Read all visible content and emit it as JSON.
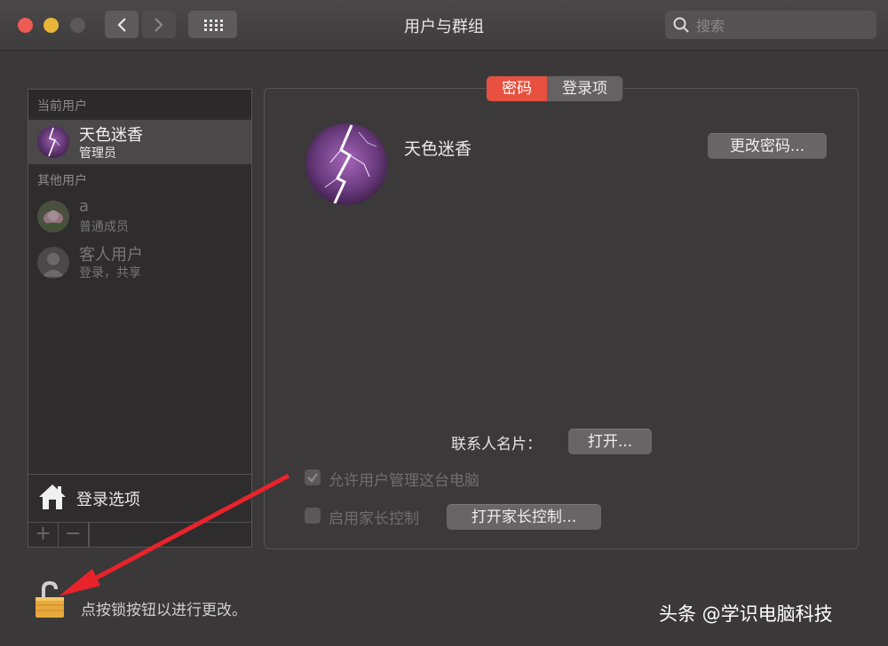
{
  "window": {
    "title": "用户与群组",
    "search_placeholder": "搜索"
  },
  "sidebar": {
    "current_users_header": "当前用户",
    "current_user": {
      "name": "天色迷香",
      "role": "管理员"
    },
    "other_users_header": "其他用户",
    "other_users": [
      {
        "name": "a",
        "role": "普通成员"
      },
      {
        "name": "客人用户",
        "role": "登录，共享"
      }
    ],
    "login_options_label": "登录选项",
    "add_label": "+",
    "remove_label": "−"
  },
  "tabs": [
    {
      "label": "密码",
      "active": true
    },
    {
      "label": "登录项",
      "active": false
    }
  ],
  "main": {
    "user_name": "天色迷香",
    "change_password_button": "更改密码...",
    "contacts_card_label": "联系人名片：",
    "open_button": "打开...",
    "allow_admin_label": "允许用户管理这台电脑",
    "allow_admin_checked": true,
    "parental_label": "启用家长控制",
    "parental_checked": false,
    "open_parental_button": "打开家长控制..."
  },
  "footer": {
    "lock_text": "点按锁按钮以进行更改。",
    "watermark": "头条 @学识电脑科技"
  },
  "colors": {
    "accent": "#e8503f",
    "window_bg": "#3a3838",
    "arrow": "#e8232b"
  }
}
